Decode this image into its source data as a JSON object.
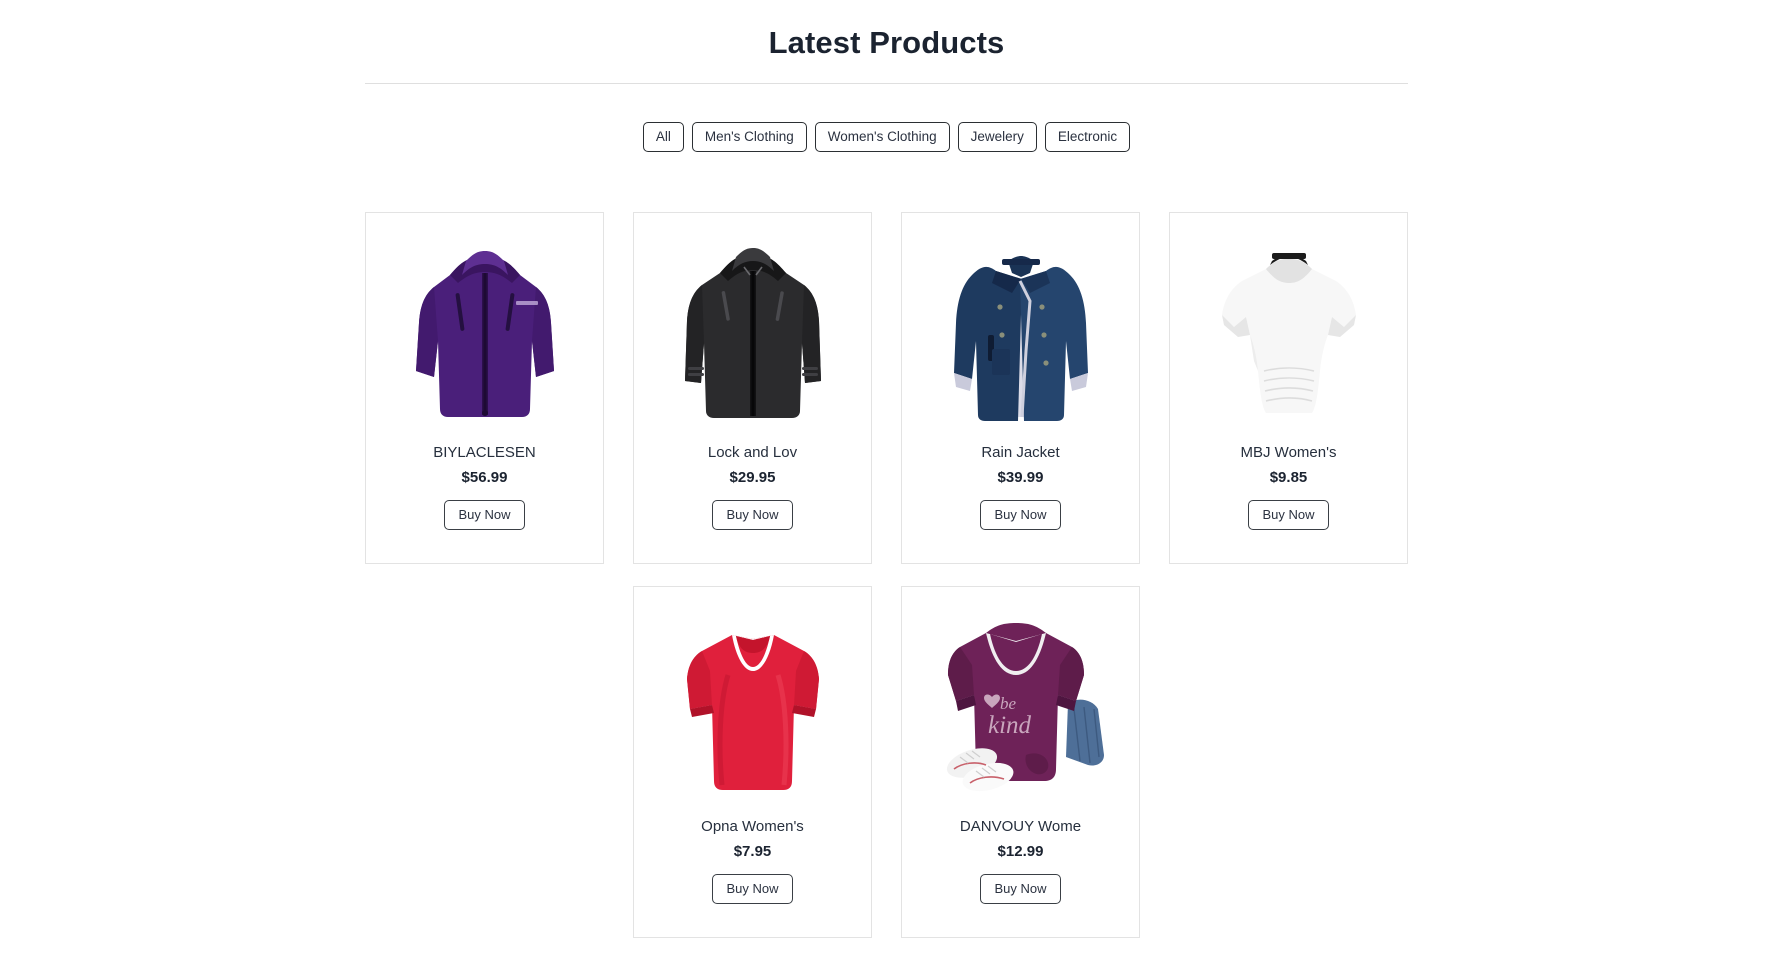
{
  "header": {
    "title": "Latest Products"
  },
  "filters": {
    "items": [
      {
        "label": "All",
        "name": "filter-all"
      },
      {
        "label": "Men's Clothing",
        "name": "filter-mens-clothing"
      },
      {
        "label": "Women's Clothing",
        "name": "filter-womens-clothing"
      },
      {
        "label": "Jewelery",
        "name": "filter-jewelery"
      },
      {
        "label": "Electronic",
        "name": "filter-electronic"
      }
    ]
  },
  "products": [
    {
      "title": "BIYLACLESEN",
      "price": "$56.99",
      "buy_label": "Buy Now",
      "image": "purple-hooded-jacket",
      "colors": {
        "main": "#4a1f7a",
        "dark": "#3a1560",
        "light": "#5e2f92"
      }
    },
    {
      "title": "Lock and Lov",
      "price": "$29.95",
      "buy_label": "Buy Now",
      "image": "black-leather-jacket",
      "colors": {
        "main": "#2b2b2d",
        "dark": "#171718",
        "light": "#454548"
      }
    },
    {
      "title": "Rain Jacket",
      "price": "$39.99",
      "buy_label": "Buy Now",
      "image": "navy-open-jacket",
      "colors": {
        "main": "#1e3a5f",
        "dark": "#152a47",
        "light": "#d8d9e6"
      }
    },
    {
      "title": "MBJ Women's",
      "price": "$9.85",
      "buy_label": "Buy Now",
      "image": "white-dolman-top",
      "colors": {
        "main": "#f7f7f7",
        "dark": "#d9d9d9",
        "light": "#ffffff"
      }
    },
    {
      "title": "Opna Women's",
      "price": "$7.95",
      "buy_label": "Buy Now",
      "image": "red-vneck-tshirt",
      "colors": {
        "main": "#e0203c",
        "dark": "#b9152c",
        "light": "#ef3b52"
      }
    },
    {
      "title": "DANVOUY Wome",
      "price": "$12.99",
      "buy_label": "Buy Now",
      "image": "purple-be-kind-tshirt",
      "colors": {
        "main": "#6e2258",
        "dark": "#571543",
        "light": "#c9a6bd"
      }
    }
  ]
}
